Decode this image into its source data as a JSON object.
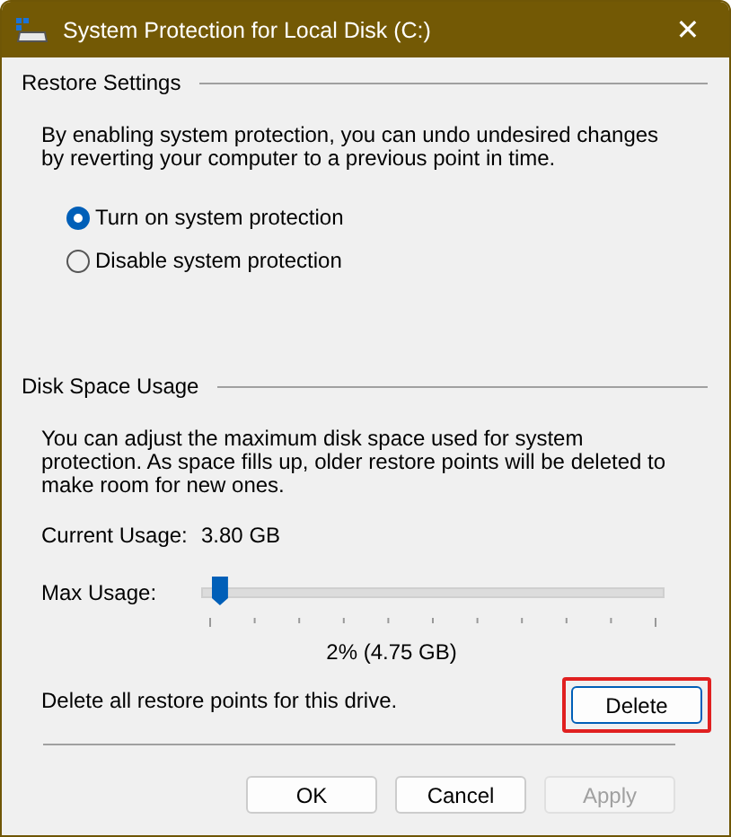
{
  "window": {
    "title": "System Protection for Local Disk (C:)",
    "close": "✕"
  },
  "restore_settings": {
    "title": "Restore Settings",
    "description": "By enabling system protection, you can undo undesired changes by reverting your computer to a previous point in time.",
    "options": [
      {
        "label": "Turn on system protection",
        "selected": true
      },
      {
        "label": "Disable system protection",
        "selected": false
      }
    ]
  },
  "disk_space_usage": {
    "title": "Disk Space Usage",
    "description": "You can adjust the maximum disk space used for system protection. As space fills up, older restore points will be deleted to make room for new ones.",
    "current_usage_label": "Current Usage:",
    "current_usage_value": "3.80 GB",
    "max_usage_label": "Max Usage:",
    "max_usage": {
      "level": 0.02,
      "reading": "2% (4.75 GB)"
    },
    "delete_text": "Delete all restore points for this drive.",
    "delete_button": {
      "label": "Delete",
      "highlighted": true
    }
  },
  "buttons": [
    {
      "label": "OK",
      "disabled": false
    },
    {
      "label": "Cancel",
      "disabled": false
    },
    {
      "label": "Apply",
      "disabled": true
    }
  ]
}
